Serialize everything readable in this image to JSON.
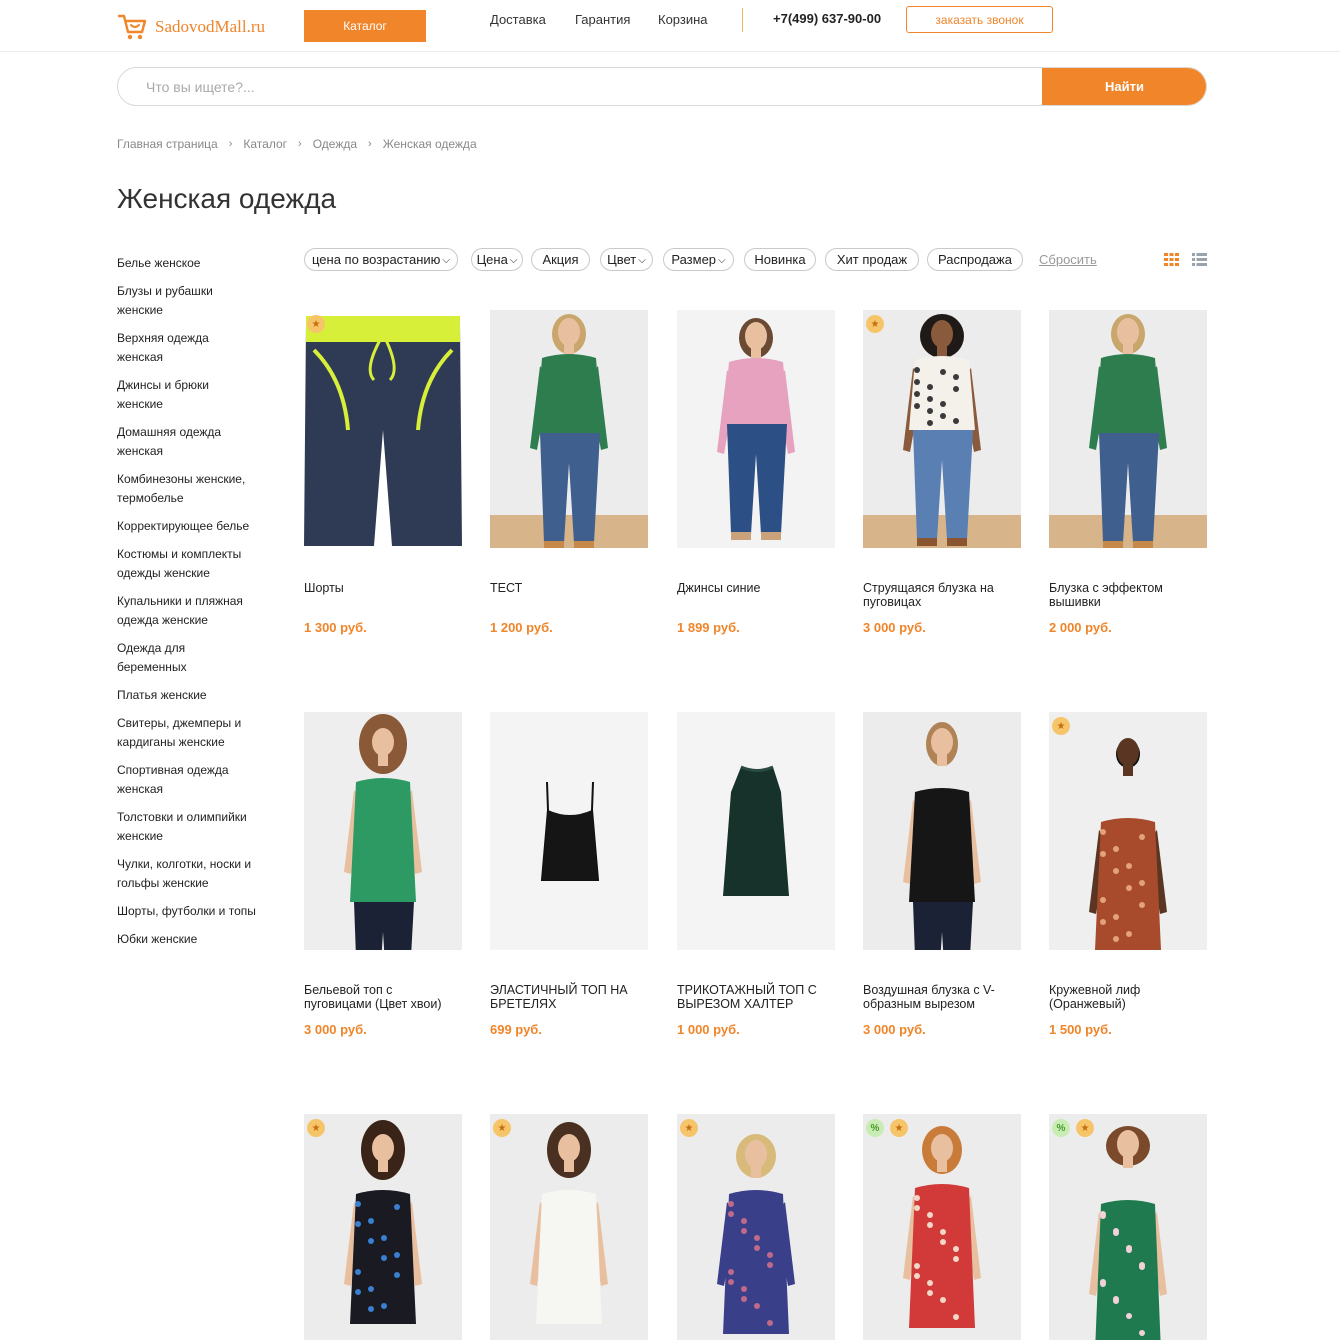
{
  "header": {
    "logo_text": "SadovodMall.ru",
    "catalog_label": "Каталог",
    "nav": [
      "Доставка",
      "Гарантия",
      "Корзина"
    ],
    "phone": "+7(499) 637-90-00",
    "callback_label": "заказать звонок",
    "accent_color": "#f0852a"
  },
  "search": {
    "placeholder": "Что вы ищете?...",
    "button_label": "Найти"
  },
  "breadcrumb": [
    "Главная страница",
    "Каталог",
    "Одежда",
    "Женская одежда"
  ],
  "page_title": "Женская одежда",
  "sidebar": {
    "items": [
      "Белье женское",
      "Блузы и рубашки женские",
      "Верхняя одежда женская",
      "Джинсы и брюки женские",
      "Домашняя одежда женская",
      "Комбинезоны женские, термобелье",
      "Корректирующее белье",
      "Костюмы и комплекты одежды женские",
      "Купальники и пляжная одежда женские",
      "Одежда для беременных",
      "Платья женские",
      "Свитеры, джемперы и кардиганы женские",
      "Спортивная одежда женская",
      "Толстовки и олимпийки женские",
      "Чулки, колготки, носки и гольфы женские",
      "Шорты, футболки и топы",
      "Юбки женские"
    ]
  },
  "filters": {
    "sort": "цена по возрастанию",
    "chips": [
      "Цена",
      "Акция",
      "Цвет",
      "Размер",
      "Новинка",
      "Хит продаж",
      "Распродажа"
    ],
    "reset_label": "Сбросить"
  },
  "products": [
    {
      "name": "Шорты",
      "price": "1 300 руб.",
      "star": true,
      "sale": false,
      "image": "navy-shorts"
    },
    {
      "name": "ТЕСТ",
      "price": "1 200 руб.",
      "star": false,
      "sale": false,
      "image": "green-blouse-jeans"
    },
    {
      "name": "Джинсы синие",
      "price": "1 899 руб.",
      "star": false,
      "sale": false,
      "image": "pink-cardigan-jeans"
    },
    {
      "name": "Струящаяся блузка на пуговицах",
      "price": "3 000 руб.",
      "star": true,
      "sale": false,
      "image": "white-dotted-blouse"
    },
    {
      "name": "Блузка с эффектом вышивки",
      "price": "2 000 руб.",
      "star": false,
      "sale": false,
      "image": "green-blouse-jeans"
    },
    {
      "name": "Бельевой топ с пуговицами (Цвет хвои)",
      "price": "3 000 руб.",
      "star": false,
      "sale": false,
      "image": "green-satin-cami"
    },
    {
      "name": "ЭЛАСТИЧНЫЙ ТОП НА БРЕТЕЛЯХ",
      "price": "699 руб.",
      "star": false,
      "sale": false,
      "image": "black-cami-flat"
    },
    {
      "name": "ТРИКОТАЖНЫЙ ТОП С ВЫРЕЗОМ ХАЛТЕР",
      "price": "1 000 руб.",
      "star": false,
      "sale": false,
      "image": "dark-green-halter-flat"
    },
    {
      "name": "Воздушная блузка с V-образным вырезом",
      "price": "3 000 руб.",
      "star": false,
      "sale": false,
      "image": "black-v-blouse"
    },
    {
      "name": "Кружевной лиф (Оранжевый)",
      "price": "1 500 руб.",
      "star": true,
      "sale": false,
      "image": "rust-lace-cami"
    },
    {
      "name": "",
      "price": "",
      "star": true,
      "sale": false,
      "image": "black-floral-cami"
    },
    {
      "name": "",
      "price": "",
      "star": true,
      "sale": false,
      "image": "white-lace-cami"
    },
    {
      "name": "",
      "price": "",
      "star": true,
      "sale": false,
      "image": "blue-print-top"
    },
    {
      "name": "",
      "price": "",
      "star": true,
      "sale": true,
      "image": "red-floral-top"
    },
    {
      "name": "",
      "price": "",
      "star": true,
      "sale": true,
      "image": "green-floral-cami"
    }
  ]
}
